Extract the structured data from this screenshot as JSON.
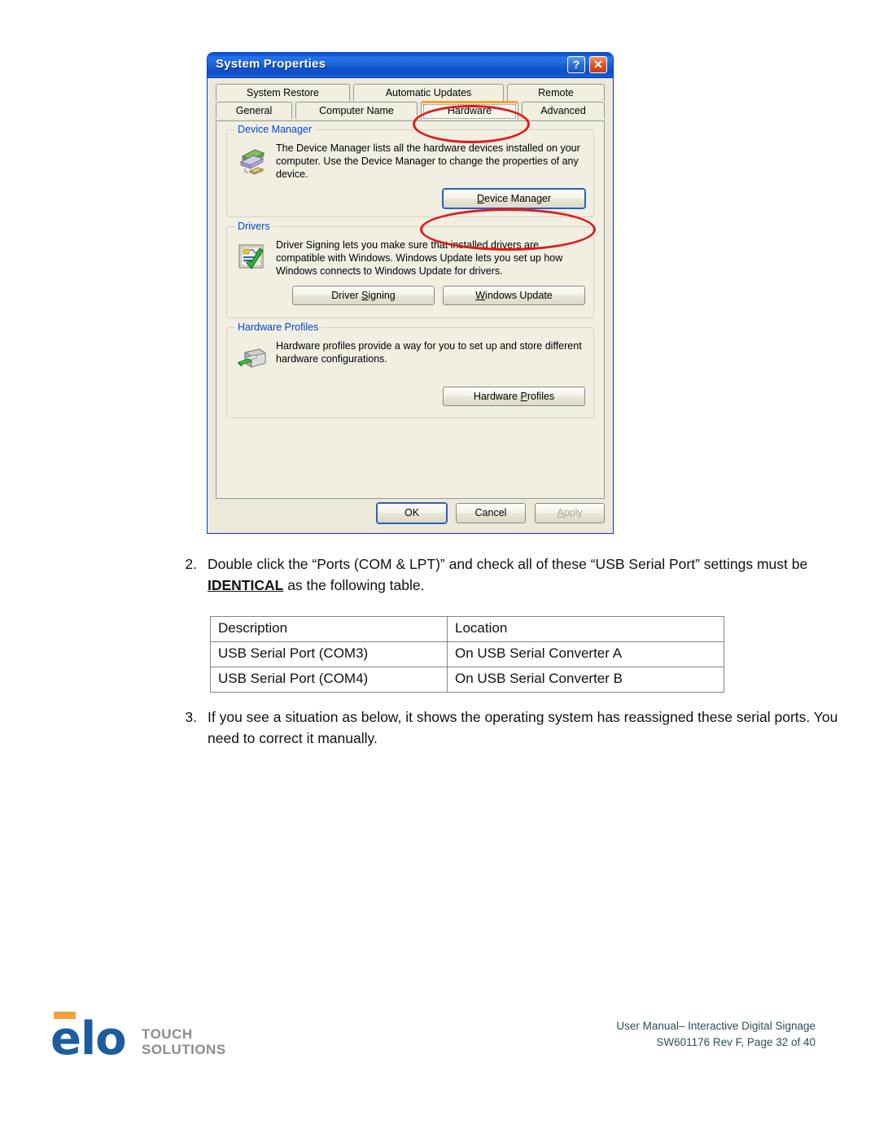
{
  "dialog": {
    "title": "System Properties",
    "titlebar_buttons": [
      {
        "name": "help-button",
        "glyph": "?"
      },
      {
        "name": "close-button",
        "glyph": "✕"
      }
    ],
    "tabs_row1": [
      {
        "label": "System Restore",
        "selected": false
      },
      {
        "label": "Automatic Updates",
        "selected": false
      },
      {
        "label": "Remote",
        "selected": false
      }
    ],
    "tabs_row2": [
      {
        "label": "General",
        "selected": false
      },
      {
        "label": "Computer Name",
        "selected": false
      },
      {
        "label": "Hardware",
        "selected": true
      },
      {
        "label": "Advanced",
        "selected": false
      }
    ],
    "groups": [
      {
        "title": "Device Manager",
        "icon": "device-manager-icon",
        "body": "The Device Manager lists all the hardware devices installed on your computer. Use the Device Manager to change the properties of any device.",
        "buttons": [
          {
            "label_pre": "",
            "label_accel": "D",
            "label_post": "evice Manager",
            "full": "Device Manager"
          }
        ]
      },
      {
        "title": "Drivers",
        "icon": "driver-signing-icon",
        "body": "Driver Signing lets you make sure that installed drivers are compatible with Windows. Windows Update lets you set up how Windows connects to Windows Update for drivers.",
        "buttons": [
          {
            "label_pre": "Driver ",
            "label_accel": "S",
            "label_post": "igning",
            "full": "Driver Signing"
          },
          {
            "label_pre": "",
            "label_accel": "W",
            "label_post": "indows Update",
            "full": "Windows Update"
          }
        ]
      },
      {
        "title": "Hardware Profiles",
        "icon": "hardware-profiles-icon",
        "body": "Hardware profiles provide a way for you to set up and store different hardware configurations.",
        "buttons": [
          {
            "label_pre": "Hardware ",
            "label_accel": "P",
            "label_post": "rofiles",
            "full": "Hardware Profiles"
          }
        ]
      }
    ],
    "footer_buttons": [
      {
        "label": "OK",
        "state": "default"
      },
      {
        "label": "Cancel",
        "state": "normal"
      },
      {
        "label_pre": "",
        "label_accel": "A",
        "label_post": "pply",
        "label": "Apply",
        "state": "disabled"
      }
    ],
    "annotations": [
      {
        "name": "hardware-tab-highlight",
        "color": "#e01b18"
      },
      {
        "name": "device-manager-button-highlight",
        "color": "#e01b18"
      }
    ]
  },
  "document": {
    "item2": {
      "number": "2.",
      "text_before": "Double click the “Ports (COM & LPT)” and check all of these “USB Serial Port” settings must be ",
      "emphasis": "IDENTICAL",
      "text_after": " as the following table."
    },
    "item3": {
      "number": "3.",
      "text": "If you see a situation as below, it shows the operating system has reassigned these serial ports. You need to correct it manually."
    },
    "table": {
      "headers": [
        "Description",
        "Location"
      ],
      "rows": [
        [
          "USB Serial Port (COM3)",
          "On USB Serial Converter A"
        ],
        [
          "USB Serial Port (COM4)",
          "On USB Serial Converter B"
        ]
      ]
    }
  },
  "page_footer": {
    "logo": {
      "word_mark": "elo",
      "line1": "TOUCH",
      "line2": "SOLUTIONS",
      "bar_color": "#f2a13c",
      "text_color": "#1d5c9e"
    },
    "line1": "User Manual– Interactive Digital Signage",
    "line2": "SW601176 Rev F, Page 32 of 40"
  }
}
